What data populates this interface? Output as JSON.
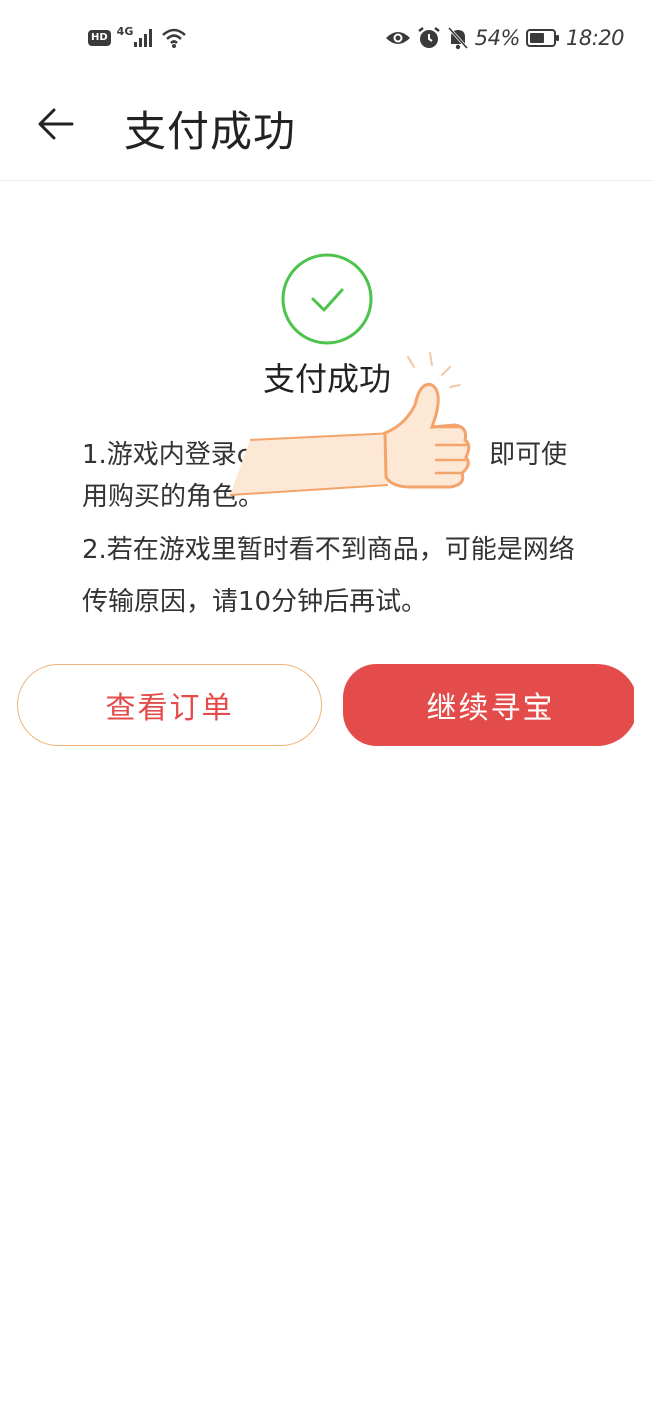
{
  "status_bar": {
    "hd": "HD",
    "network": "4G",
    "battery_percent": "54%",
    "time": "18:20",
    "icons": [
      "signal-icon",
      "wifi-icon",
      "eye-icon",
      "alarm-icon",
      "mute-bell-icon",
      "battery-icon"
    ]
  },
  "header": {
    "back_icon": "arrow-left-icon",
    "title": "支付成功"
  },
  "result": {
    "icon": "check-circle-icon",
    "icon_color": "#4cc34c",
    "title": "支付成功"
  },
  "notes": [
    "1.游戏内登录c ... 即可使用购买的角色。",
    "2.若在游戏里暂时看不到商品，可能是网络传输原因，请10分钟后再试。"
  ],
  "notes_display": {
    "line1_start": "1.游戏内登录c",
    "line1_end": "即可使",
    "line2": "用购买的角色。",
    "note2": "2.若在游戏里暂时看不到商品，可能是网络传输原因，请10分钟后再试。"
  },
  "buttons": {
    "view_order": "查看订单",
    "continue": "继续寻宝"
  },
  "colors": {
    "accent": "#e44b4b",
    "outline": "#f0b47a",
    "success": "#4cc34c"
  }
}
